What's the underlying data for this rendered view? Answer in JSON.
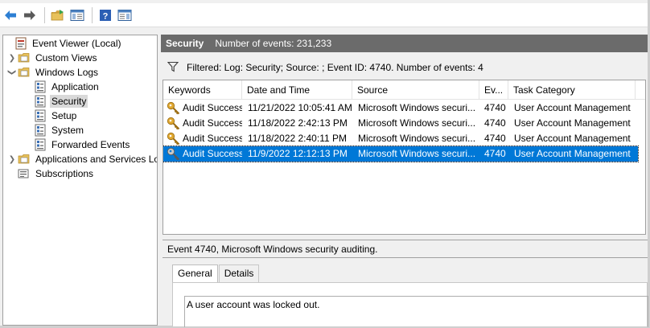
{
  "toolbar": {
    "buttons": [
      "back-arrow-icon",
      "forward-arrow-icon",
      "open-folder-icon",
      "show-hide-console-tree-icon",
      "help-icon",
      "action-pane-icon"
    ]
  },
  "tree": {
    "root": "Event Viewer (Local)",
    "custom_views": "Custom Views",
    "windows_logs": "Windows Logs",
    "logs": [
      "Application",
      "Security",
      "Setup",
      "System",
      "Forwarded Events"
    ],
    "apps_services": "Applications and Services Lo",
    "subscriptions": "Subscriptions",
    "selected": "Security"
  },
  "header": {
    "title": "Security",
    "count": "Number of events: 231,233"
  },
  "filter": {
    "text": "Filtered: Log: Security; Source: ; Event ID: 4740. Number of events: 4"
  },
  "grid": {
    "columns": [
      "Keywords",
      "Date and Time",
      "Source",
      "Ev...",
      "Task Category"
    ],
    "rows": [
      {
        "keywords": "Audit Success",
        "date": "11/21/2022 10:05:41 AM",
        "source": "Microsoft Windows securi...",
        "event": "4740",
        "task": "User Account Management"
      },
      {
        "keywords": "Audit Success",
        "date": "11/18/2022 2:42:13 PM",
        "source": "Microsoft Windows securi...",
        "event": "4740",
        "task": "User Account Management"
      },
      {
        "keywords": "Audit Success",
        "date": "11/18/2022 2:40:11 PM",
        "source": "Microsoft Windows securi...",
        "event": "4740",
        "task": "User Account Management"
      },
      {
        "keywords": "Audit Success",
        "date": "11/9/2022 12:12:13 PM",
        "source": "Microsoft Windows securi...",
        "event": "4740",
        "task": "User Account Management"
      }
    ],
    "selected_row": 3
  },
  "details": {
    "title": "Event 4740, Microsoft Windows security auditing.",
    "tabs": [
      "General",
      "Details"
    ],
    "active_tab": "General",
    "description": "A user account was locked out."
  },
  "colors": {
    "header_bg": "#6b6b6b",
    "selection": "#0078d7",
    "tree_selected": "#d9d9d9"
  }
}
